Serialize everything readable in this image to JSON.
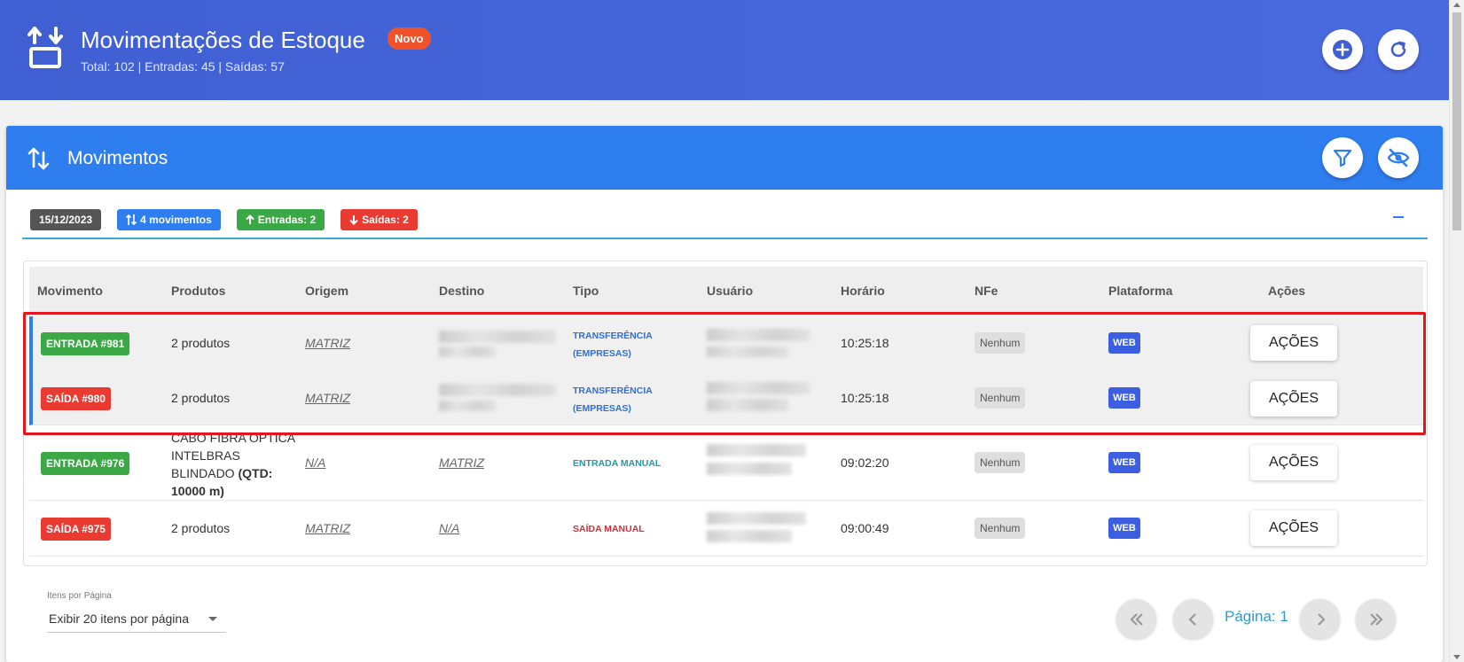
{
  "header": {
    "title": "Movimentações de Estoque",
    "badge": "Novo",
    "subtitle": "Total: 102 | Entradas: 45 | Saídas: 57",
    "icons": [
      "stock-transfer-icon",
      "add-icon",
      "refresh-icon"
    ]
  },
  "card": {
    "title": "Movimentos",
    "icons": [
      "sort-arrows-icon",
      "filter-icon",
      "eye-off-icon"
    ]
  },
  "chips": {
    "date": "15/12/2023",
    "movimentos": "4 movimentos",
    "entradas": "Entradas: 2",
    "saidas": "Saídas: 2"
  },
  "table": {
    "columns": [
      "Movimento",
      "Produtos",
      "Origem",
      "Destino",
      "Tipo",
      "Usuário",
      "Horário",
      "NFe",
      "Plataforma",
      "Ações"
    ],
    "rows": [
      {
        "movimento": "ENTRADA #981",
        "kind": "in",
        "produtos": "2 produtos",
        "origem": "MATRIZ",
        "destino": "",
        "tipo_l1": "TRANSFERÊNCIA",
        "tipo_l2": "(EMPRESAS)",
        "horario": "10:25:18",
        "nfe": "Nenhum",
        "plataforma": "WEB",
        "acoes": "AÇÕES"
      },
      {
        "movimento": "SAÍDA #980",
        "kind": "out",
        "produtos": "2 produtos",
        "origem": "MATRIZ",
        "destino": "",
        "tipo_l1": "TRANSFERÊNCIA",
        "tipo_l2": "(EMPRESAS)",
        "horario": "10:25:18",
        "nfe": "Nenhum",
        "plataforma": "WEB",
        "acoes": "AÇÕES"
      },
      {
        "movimento": "ENTRADA #976",
        "kind": "in",
        "produtos_l1": "CABO FIBRA OPTICA",
        "produtos_l2": "INTELBRAS",
        "produtos_l3": "BLINDADO",
        "produtos_qtd": "(QTD:",
        "produtos_qtd2": "10000 m)",
        "origem": "N/A",
        "destino": "MATRIZ",
        "tipo_l1": "ENTRADA MANUAL",
        "horario": "09:02:20",
        "nfe": "Nenhum",
        "plataforma": "WEB",
        "acoes": "AÇÕES"
      },
      {
        "movimento": "SAÍDA #975",
        "kind": "out",
        "produtos": "2 produtos",
        "origem": "MATRIZ",
        "destino": "N/A",
        "tipo_l1": "SAÍDA MANUAL",
        "horario": "09:00:49",
        "nfe": "Nenhum",
        "plataforma": "WEB",
        "acoes": "AÇÕES"
      }
    ]
  },
  "pagination": {
    "label": "Itens por Página",
    "selected": "Exibir 20 itens por página",
    "page": "Página: 1"
  },
  "colors": {
    "header_bg": "#4262d8",
    "card_header": "#2f7ef0",
    "entrada": "#3aa845",
    "saida": "#ea3b33",
    "highlight": "#e8141c"
  }
}
